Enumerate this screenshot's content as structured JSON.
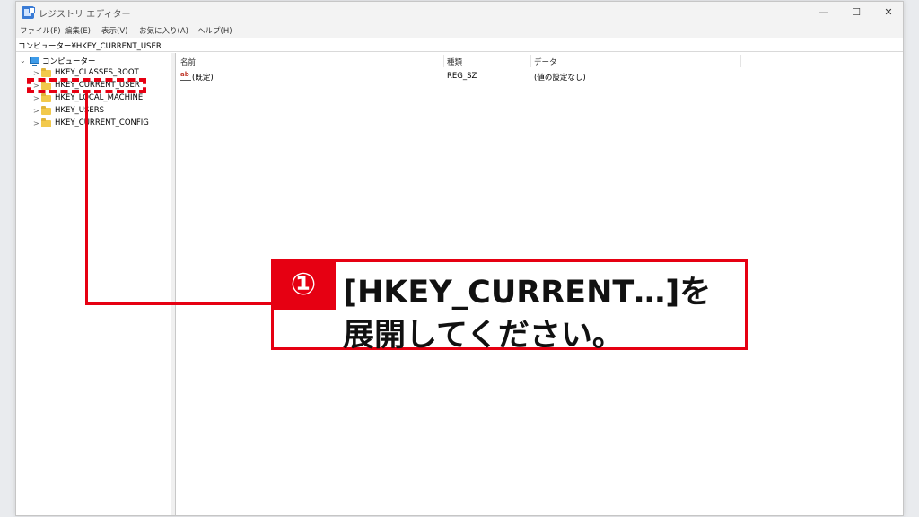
{
  "window": {
    "title": "レジストリ エディター",
    "controls": {
      "minimize": "—",
      "maximize": "☐",
      "close": "✕"
    }
  },
  "menu": {
    "items": [
      {
        "label": "ファイル(F)"
      },
      {
        "label": "編集(E)"
      },
      {
        "label": "表示(V)"
      },
      {
        "label": "お気に入り(A)"
      },
      {
        "label": "ヘルプ(H)"
      }
    ]
  },
  "address": {
    "path": "コンピューター¥HKEY_CURRENT_USER"
  },
  "tree": {
    "root": {
      "label": "コンピューター",
      "icon": "computer-icon",
      "expanded": true
    },
    "keys": [
      {
        "label": "HKEY_CLASSES_ROOT",
        "icon": "folder-icon"
      },
      {
        "label": "HKEY_CURRENT_USER",
        "icon": "folder-icon",
        "selected": true
      },
      {
        "label": "HKEY_LOCAL_MACHINE",
        "icon": "folder-icon"
      },
      {
        "label": "HKEY_USERS",
        "icon": "folder-icon"
      },
      {
        "label": "HKEY_CURRENT_CONFIG",
        "icon": "folder-icon"
      }
    ],
    "chevron_collapsed": ">",
    "chevron_expanded": "⌄"
  },
  "list": {
    "columns": [
      "名前",
      "種類",
      "データ"
    ],
    "rows": [
      {
        "icon": "ab",
        "name": "(既定)",
        "type": "REG_SZ",
        "data": "(値の設定なし)"
      }
    ]
  },
  "annotation": {
    "step_number": "①",
    "line1": "[HKEY_CURRENT…]を",
    "line2": "展開してください。",
    "accent_color": "#e60012"
  }
}
